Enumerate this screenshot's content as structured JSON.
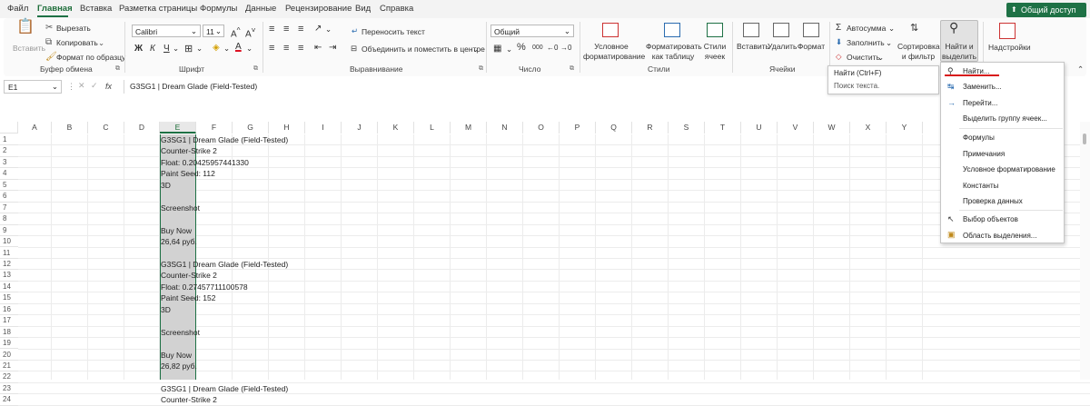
{
  "tabs": [
    "Файл",
    "Главная",
    "Вставка",
    "Разметка страницы",
    "Формулы",
    "Данные",
    "Рецензирование",
    "Вид",
    "Справка"
  ],
  "share_label": "Общий доступ",
  "clipboard": {
    "paste": "Вставить",
    "cut": "Вырезать",
    "copy": "Копировать",
    "format_painter": "Формат по образцу",
    "group": "Буфер обмена"
  },
  "font": {
    "name": "Calibri",
    "size": "11",
    "bold": "Ж",
    "italic": "К",
    "underline": "Ч",
    "grow": "A^",
    "shrink": "A˅",
    "group": "Шрифт"
  },
  "alignment": {
    "wrap": "Переносить текст",
    "merge": "Объединить и поместить в центре",
    "group": "Выравнивание"
  },
  "number": {
    "format": "Общий",
    "percent": "%",
    "thousands": "000",
    "group": "Число"
  },
  "styles": {
    "conditional": "Условное форматирование",
    "as_table": "Форматировать как таблицу",
    "cell_styles": "Стили ячеек",
    "group": "Стили"
  },
  "cells": {
    "insert": "Вставить",
    "delete": "Удалить",
    "format": "Формат",
    "group": "Ячейки"
  },
  "editing": {
    "autosum": "Автосумма",
    "fill": "Заполнить",
    "clear": "Очистить",
    "sort": "Сортировка и фильтр",
    "find": "Найти и выделить"
  },
  "addins": {
    "label": "Надстройки"
  },
  "formula_bar": {
    "name_box": "E1",
    "fx": "fx",
    "content": "G3SG1 | Dream Glade (Field-Tested)"
  },
  "columns": [
    "A",
    "B",
    "C",
    "D",
    "E",
    "F",
    "G",
    "H",
    "I",
    "J",
    "K",
    "L",
    "M",
    "N",
    "O",
    "P",
    "Q",
    "R",
    "S",
    "T",
    "U",
    "V",
    "W",
    "X",
    "Y"
  ],
  "rows": [
    "1",
    "2",
    "3",
    "4",
    "5",
    "6",
    "7",
    "8",
    "9",
    "10",
    "11",
    "12",
    "13",
    "14",
    "15",
    "16",
    "17",
    "18",
    "19",
    "20",
    "21",
    "22",
    "23",
    "24"
  ],
  "cells_e": [
    {
      "row": 1,
      "text": "G3SG1 | Dream Glade (Field-Tested)"
    },
    {
      "row": 2,
      "text": "Counter-Strike 2"
    },
    {
      "row": 3,
      "text": "Float: 0.20425957441330"
    },
    {
      "row": 4,
      "text": "Paint Seed: 112"
    },
    {
      "row": 5,
      "text": "3D"
    },
    {
      "row": 7,
      "text": "Screenshot"
    },
    {
      "row": 9,
      "text": "Buy Now"
    },
    {
      "row": 10,
      "text": "26,64 руб."
    },
    {
      "row": 12,
      "text": "G3SG1 | Dream Glade (Field-Tested)"
    },
    {
      "row": 13,
      "text": "Counter-Strike 2"
    },
    {
      "row": 14,
      "text": "Float: 0.27457711100578"
    },
    {
      "row": 15,
      "text": "Paint Seed: 152"
    },
    {
      "row": 16,
      "text": "3D"
    },
    {
      "row": 18,
      "text": "Screenshot"
    },
    {
      "row": 20,
      "text": "Buy Now"
    },
    {
      "row": 21,
      "text": "26,82 руб."
    },
    {
      "row": 23,
      "text": "G3SG1 | Dream Glade (Field-Tested)"
    },
    {
      "row": 24,
      "text": "Counter-Strike 2"
    }
  ],
  "tooltip": {
    "title": "Найти (Ctrl+F)",
    "desc": "Поиск текста."
  },
  "menu": {
    "find": "Найти...",
    "replace": "Заменить...",
    "goto": "Перейти...",
    "goto_special": "Выделить группу ячеек...",
    "formulas": "Формулы",
    "notes": "Примечания",
    "cond_format": "Условное форматирование",
    "constants": "Константы",
    "validation": "Проверка данных",
    "select_objects": "Выбор объектов",
    "selection_pane": "Область выделения..."
  }
}
